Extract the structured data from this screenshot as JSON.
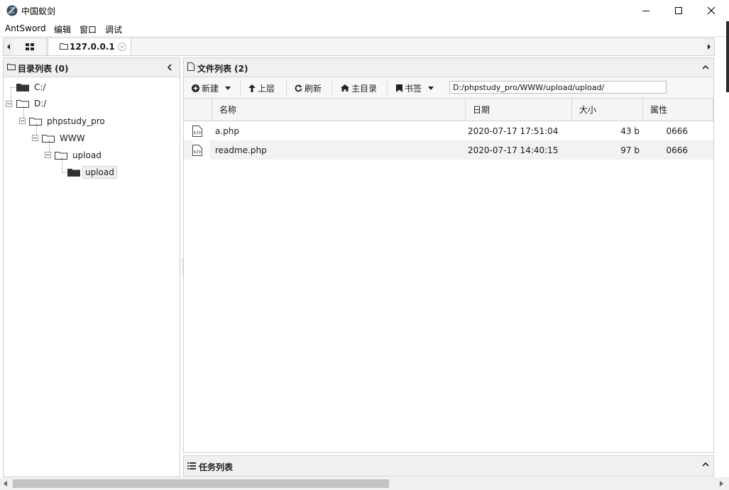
{
  "window": {
    "title": "中国蚁剑"
  },
  "menu": [
    "AntSword",
    "编辑",
    "窗口",
    "调试"
  ],
  "tabs": {
    "host": "127.0.0.1"
  },
  "tree_panel": {
    "title": "目录列表 (0)",
    "nodes": [
      {
        "label": "C:/",
        "depth": 0,
        "folder": "filled"
      },
      {
        "label": "D:/",
        "depth": 0,
        "folder": "outline"
      },
      {
        "label": "phpstudy_pro",
        "depth": 1,
        "folder": "outline"
      },
      {
        "label": "WWW",
        "depth": 2,
        "folder": "outline"
      },
      {
        "label": "upload",
        "depth": 3,
        "folder": "outline"
      },
      {
        "label": "upload",
        "depth": 4,
        "folder": "filled",
        "selected": true
      }
    ]
  },
  "file_panel": {
    "title": "文件列表 (2)",
    "toolbar": {
      "new": "新建",
      "up": "上层",
      "refresh": "刷新",
      "home": "主目录",
      "bookmark": "书签",
      "path": "D:/phpstudy_pro/WWW/upload/upload/"
    },
    "columns": [
      "名称",
      "日期",
      "大小",
      "属性"
    ],
    "rows": [
      {
        "name": "a.php",
        "date": "2020-07-17 17:51:04",
        "size": "43 b",
        "attr": "0666"
      },
      {
        "name": "readme.php",
        "date": "2020-07-17 14:40:15",
        "size": "97 b",
        "attr": "0666"
      }
    ]
  },
  "task_panel": {
    "title": "任务列表"
  },
  "colors": {
    "selected_row": "#f2f2f2",
    "header_bg": "#f0f0f0",
    "border": "#cfcfcf"
  }
}
